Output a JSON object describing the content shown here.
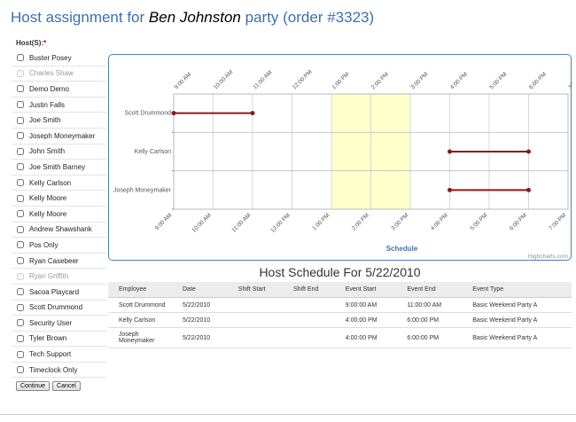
{
  "header": {
    "title_prefix": "Host assignment for",
    "title_name": "Ben Johnston",
    "title_suffix": "party (order #3323)"
  },
  "hosts": {
    "label": "Host(S):",
    "required_mark": "*",
    "items": [
      {
        "label": "Buster Posey",
        "disabled": false
      },
      {
        "label": "Charles Shaw",
        "disabled": true
      },
      {
        "label": "Demo Demo",
        "disabled": false
      },
      {
        "label": "Justin Falls",
        "disabled": false
      },
      {
        "label": "Joe Smith",
        "disabled": false
      },
      {
        "label": "Joseph Moneymaker",
        "disabled": false
      },
      {
        "label": "John Smith",
        "disabled": false
      },
      {
        "label": "Joe Smith Barney",
        "disabled": false
      },
      {
        "label": "Kelly Carlson",
        "disabled": false
      },
      {
        "label": "Kelly Moore",
        "disabled": false
      },
      {
        "label": "Kelly Moore",
        "disabled": false
      },
      {
        "label": "Andrew Shawshank",
        "disabled": false
      },
      {
        "label": "Pos Only",
        "disabled": false
      },
      {
        "label": "Ryan Casebeer",
        "disabled": false
      },
      {
        "label": "Ryan Griffith",
        "disabled": true
      },
      {
        "label": "Sacoa Playcard",
        "disabled": false
      },
      {
        "label": "Scott Drummond",
        "disabled": false
      },
      {
        "label": "Security User",
        "disabled": false
      },
      {
        "label": "Tyler Brown",
        "disabled": false
      },
      {
        "label": "Tech Support",
        "disabled": false
      },
      {
        "label": "Timeclock Only",
        "disabled": false
      }
    ]
  },
  "buttons": {
    "continue": "Continue",
    "cancel": "Cancel"
  },
  "chart_data": {
    "type": "gantt",
    "xlabel": "Schedule",
    "credit": "Highcharts.com",
    "x_ticks": [
      "9:00 AM",
      "10:00 AM",
      "11:00 AM",
      "12:00 PM",
      "1:00 PM",
      "2:00 PM",
      "3:00 PM",
      "4:00 PM",
      "5:00 PM",
      "6:00 PM",
      "7:00 PM"
    ],
    "xlim": [
      9,
      19
    ],
    "categories": [
      "Scott Drummond",
      "Kelly Carlson",
      "Joseph Moneymaker"
    ],
    "bars": [
      {
        "category": "Scott Drummond",
        "start": 9,
        "end": 11
      },
      {
        "category": "Kelly Carlson",
        "start": 16,
        "end": 18
      },
      {
        "category": "Joseph Moneymaker",
        "start": 16,
        "end": 18
      }
    ],
    "plot_band": {
      "from": 13,
      "to": 15,
      "color": "#ffffcc"
    },
    "bar_color": "#8b1a1a",
    "grid": true
  },
  "schedule": {
    "title": "Host Schedule For 5/22/2010",
    "columns": [
      "Employee",
      "Date",
      "Shift Start",
      "Shift End",
      "Event Start",
      "Event End",
      "Event Type"
    ],
    "rows": [
      [
        "Scott Drummond",
        "5/22/2010",
        "",
        "",
        "9:00:00 AM",
        "11:00:00 AM",
        "Basic Weekend Party A"
      ],
      [
        "Kelly Carlson",
        "5/22/2010",
        "",
        "",
        "4:00:00 PM",
        "6:00:00 PM",
        "Basic Weekend Party A"
      ],
      [
        "Joseph Moneymaker",
        "5/22/2010",
        "",
        "",
        "4:00:00 PM",
        "6:00:00 PM",
        "Basic Weekend Party A"
      ]
    ]
  }
}
